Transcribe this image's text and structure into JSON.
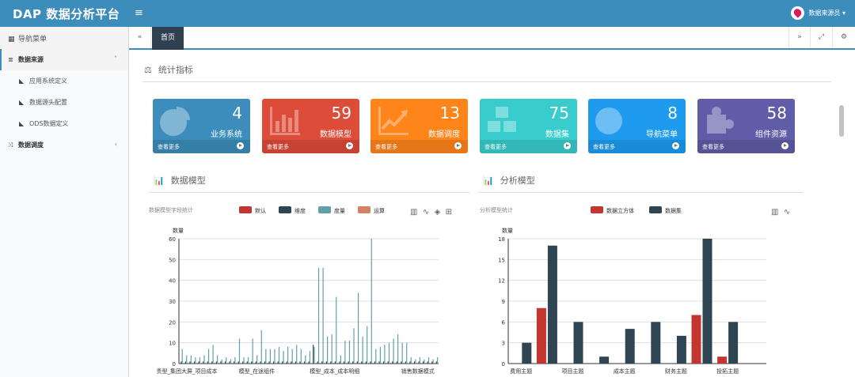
{
  "header": {
    "brand": "DAP 数据分析平台",
    "menu_icon": "bars-icon",
    "user_name": "数据来源员 ▾"
  },
  "sidebar": {
    "title": "导航菜单",
    "items": [
      {
        "label": "数据来源",
        "caret": "˅"
      },
      {
        "label": "应用系统定义"
      },
      {
        "label": "数据源头配置"
      },
      {
        "label": "ODS数据定义"
      },
      {
        "label": "数据调度",
        "caret": "‹"
      }
    ]
  },
  "tabs": {
    "home": "首页"
  },
  "stats": {
    "title": "统计指标",
    "cards": [
      {
        "value": "4",
        "label": "业务系统",
        "more": "查看更多",
        "color": "#3c8dbc",
        "icon": "pie-chart-icon"
      },
      {
        "value": "59",
        "label": "数据模型",
        "more": "查看更多",
        "color": "#dd4b39",
        "icon": "bar-chart-icon"
      },
      {
        "value": "13",
        "label": "数据调度",
        "more": "查看更多",
        "color": "#ff851b",
        "icon": "line-chart-icon"
      },
      {
        "value": "75",
        "label": "数据集",
        "more": "查看更多",
        "color": "#39cccc",
        "icon": "cubes-icon"
      },
      {
        "value": "8",
        "label": "导航菜单",
        "more": "查看更多",
        "color": "#1e9bef",
        "icon": "globe-icon"
      },
      {
        "value": "58",
        "label": "组件资源",
        "more": "查看更多",
        "color": "#605ca8",
        "icon": "puzzle-icon"
      }
    ]
  },
  "panels": {
    "model_title": "数据模型",
    "analysis_title": "分析模型"
  },
  "chart_data": [
    {
      "type": "bar",
      "title": "数据模型字段统计",
      "ylabel": "数量",
      "ylim": [
        0,
        60
      ],
      "yticks": [
        0,
        10,
        20,
        30,
        40,
        50,
        60
      ],
      "tick_labels": [
        "责型_集团大屏_项目成本",
        "模型_在途组件",
        "模型_成本_成本明细",
        "销售数据模式"
      ],
      "legend": [
        {
          "name": "默认",
          "color": "#c23531"
        },
        {
          "name": "维度",
          "color": "#2f4554"
        },
        {
          "name": "度量",
          "color": "#61a0a8"
        },
        {
          "name": "运算",
          "color": "#d48265"
        }
      ],
      "series": [
        {
          "name": "默认",
          "values": [
            0,
            0,
            0,
            0,
            0,
            0,
            0,
            0,
            0,
            0,
            0,
            0,
            0,
            0,
            0,
            0,
            0,
            0,
            0,
            0,
            0,
            0,
            0,
            0,
            0,
            0,
            0,
            0,
            0,
            0,
            0,
            0,
            0,
            0,
            0,
            0,
            0,
            0,
            0,
            0,
            0,
            0,
            0,
            0,
            0,
            0,
            0,
            0,
            0,
            0,
            0,
            0,
            0,
            0,
            0,
            0,
            0,
            0,
            0
          ]
        },
        {
          "name": "维度",
          "values": [
            1,
            1,
            1,
            1,
            1,
            1,
            1,
            1,
            1,
            1,
            1,
            1,
            1,
            1,
            1,
            1,
            1,
            1,
            1,
            1,
            1,
            1,
            1,
            1,
            1,
            1,
            1,
            1,
            1,
            1,
            9,
            1,
            1,
            1,
            1,
            1,
            1,
            1,
            1,
            1,
            1,
            1,
            1,
            1,
            1,
            1,
            1,
            1,
            1,
            1,
            1,
            1,
            1,
            1,
            1,
            1,
            1,
            1,
            1
          ]
        },
        {
          "name": "度量",
          "values": [
            7,
            4,
            4,
            3,
            3,
            4,
            7,
            9,
            4,
            2,
            3,
            2,
            3,
            12,
            3,
            3,
            12,
            4,
            16,
            7,
            7,
            7,
            8,
            6,
            8,
            7,
            9,
            7,
            4,
            6,
            8,
            46,
            46,
            13,
            14,
            32,
            4,
            11,
            11,
            17,
            34,
            13,
            18,
            60,
            7,
            8,
            9,
            10,
            12,
            14,
            10,
            10,
            3,
            2,
            3,
            2,
            3,
            2,
            3
          ]
        },
        {
          "name": "运算",
          "values": [
            0,
            0,
            0,
            0,
            0,
            0,
            0,
            0,
            0,
            0,
            0,
            0,
            0,
            0,
            0,
            0,
            0,
            0,
            0,
            0,
            0,
            0,
            0,
            0,
            0,
            0,
            0,
            0,
            0,
            0,
            0,
            0,
            0,
            0,
            0,
            0,
            0,
            0,
            0,
            0,
            0,
            0,
            0,
            0,
            0,
            0,
            0,
            0,
            0,
            0,
            0,
            0,
            0,
            0,
            0,
            0,
            0,
            0,
            0
          ]
        }
      ]
    },
    {
      "type": "bar",
      "title": "分析模型统计",
      "ylabel": "数量",
      "ylim": [
        0,
        18
      ],
      "yticks": [
        0,
        3,
        6,
        9,
        12,
        15,
        18
      ],
      "categories": [
        "费用主题",
        "项目主题",
        "成本主题",
        "财务主题",
        "投拓主题"
      ],
      "x_slots": 10,
      "legend": [
        {
          "name": "数据立方体",
          "color": "#c23531"
        },
        {
          "name": "数据集",
          "color": "#2f4554"
        }
      ],
      "series": [
        {
          "name": "数据立方体",
          "values": [
            0,
            8,
            0,
            0,
            0,
            0,
            0,
            7,
            1,
            0
          ]
        },
        {
          "name": "数据集",
          "values": [
            3,
            17,
            6,
            1,
            5,
            6,
            4,
            18,
            6,
            0
          ]
        }
      ]
    }
  ]
}
